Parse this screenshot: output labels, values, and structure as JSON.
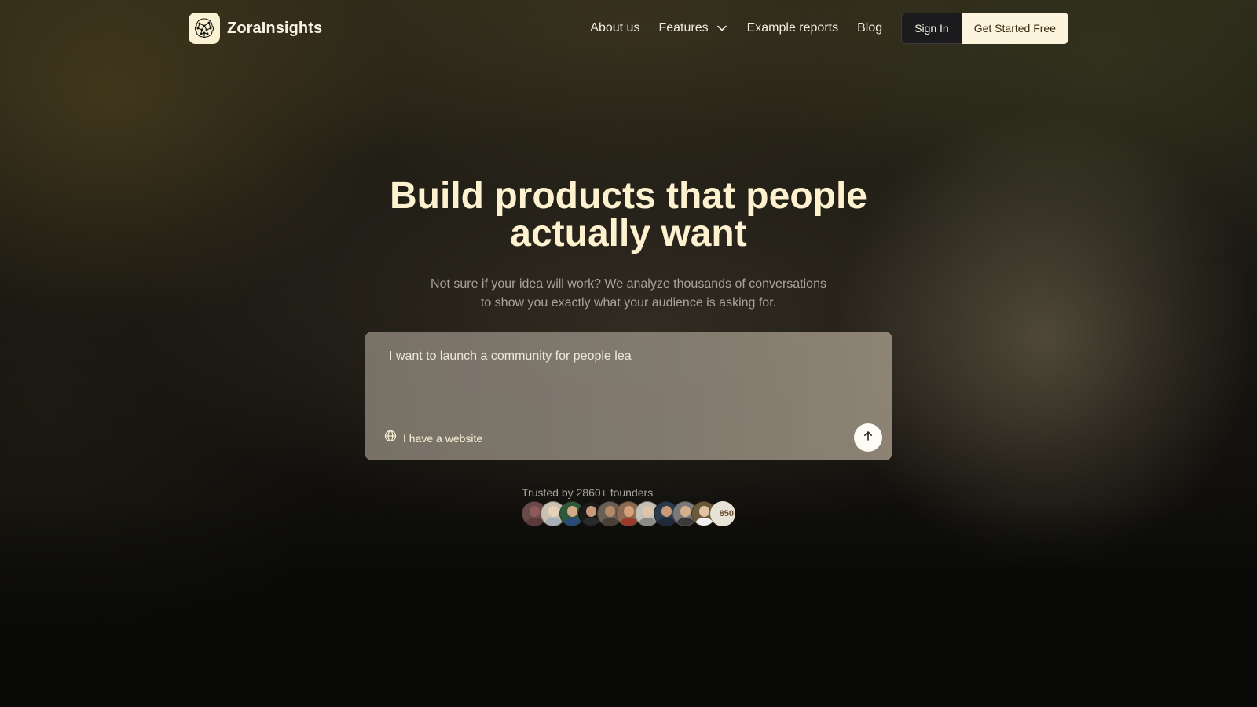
{
  "brand": {
    "name": "ZoraInsights",
    "logo_icon": "brain-network-icon"
  },
  "nav": {
    "items": [
      {
        "label": "About us"
      },
      {
        "label": "Features",
        "icon": "chevron-down-icon"
      },
      {
        "label": "Example reports"
      },
      {
        "label": "Blog"
      }
    ],
    "sign_in_label": "Sign In",
    "get_started_label": "Get Started Free"
  },
  "hero": {
    "title_line1": "Build products that people",
    "title_line2": "actually want",
    "subtitle_line1": "Not sure if your idea will work? We analyze thousands of conversations",
    "subtitle_line2": "to show you exactly what your audience is asking for."
  },
  "prompt": {
    "value": "I want to launch a community for people lea",
    "website_toggle_label": "I have a website",
    "website_icon": "globe-icon",
    "submit_icon": "arrow-up-icon"
  },
  "social_proof": {
    "trusted_text": "Trusted by 2860+ founders",
    "more_count": "850",
    "avatar_colors": [
      [
        "#6a4a4a",
        "#8c5a5a",
        "#5a3b3b"
      ],
      [
        "#c9c2b2",
        "#e6d2b8",
        "#a7b0b9"
      ],
      [
        "#2f5a3a",
        "#d4a98a",
        "#2b4a7a"
      ],
      [
        "#1a1a1a",
        "#c79a7a",
        "#2a2a2a"
      ],
      [
        "#6a6056",
        "#b58a6a",
        "#4a4038"
      ],
      [
        "#8a6a52",
        "#d6a07a",
        "#9a3a2a"
      ],
      [
        "#c6c0b6",
        "#e0c6a8",
        "#8a8a8a"
      ],
      [
        "#2a3a4a",
        "#c99a7a",
        "#1e2a3a"
      ],
      [
        "#7a7a7a",
        "#d6b08a",
        "#3a3a3a"
      ],
      [
        "#6a5a3a",
        "#e2c2a0",
        "#f0f0f0"
      ]
    ]
  },
  "colors": {
    "title": "#fdf1cf",
    "accent_button_bg": "#fdf4de",
    "accent_button_text": "#3a2a14",
    "muted_text": "#a9a399"
  }
}
